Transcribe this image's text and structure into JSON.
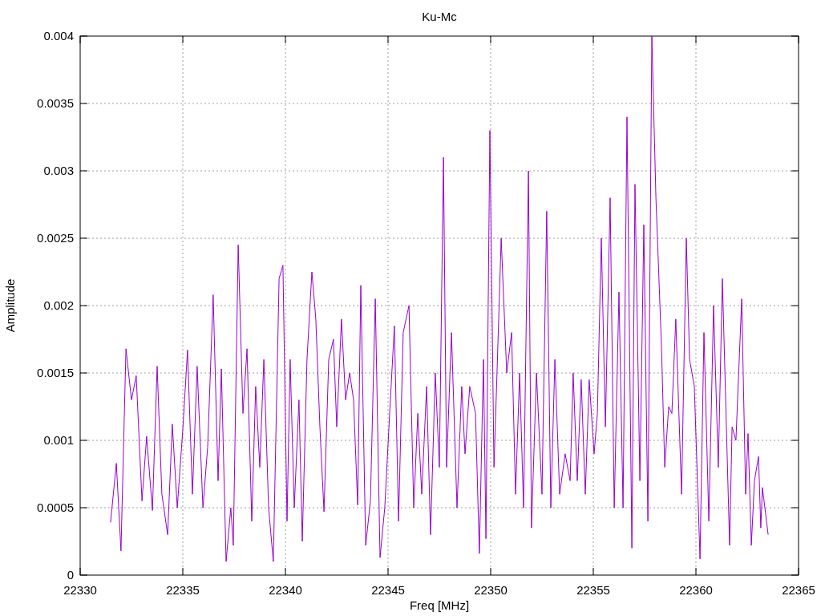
{
  "chart_data": {
    "type": "line",
    "grid": true,
    "title": "Ku-Mc",
    "xlabel": "Freq [MHz]",
    "ylabel": "Amplitude",
    "xlim": [
      22330,
      22365
    ],
    "ylim": [
      0,
      0.004
    ],
    "xticks": [
      22330,
      22335,
      22340,
      22345,
      22350,
      22355,
      22360,
      22365
    ],
    "yticks": [
      0,
      0.0005,
      0.001,
      0.0015,
      0.002,
      0.0025,
      0.003,
      0.0035,
      0.004
    ],
    "x": [
      22331.48,
      22331.76,
      22331.99,
      22332.23,
      22332.5,
      22332.73,
      22333.01,
      22333.24,
      22333.52,
      22333.75,
      22333.98,
      22334.26,
      22334.49,
      22334.73,
      22335,
      22335.23,
      22335.47,
      22335.7,
      22335.98,
      22336.21,
      22336.48,
      22336.72,
      22336.88,
      22337.11,
      22337.34,
      22337.46,
      22337.7,
      22337.93,
      22338.13,
      22338.36,
      22338.55,
      22338.75,
      22338.95,
      22339.18,
      22339.41,
      22339.69,
      22339.88,
      22340.08,
      22340.23,
      22340.43,
      22340.66,
      22340.82,
      22341.05,
      22341.29,
      22341.48,
      22341.68,
      22341.88,
      22342.11,
      22342.34,
      22342.5,
      22342.73,
      22342.93,
      22343.13,
      22343.32,
      22343.52,
      22343.67,
      22343.91,
      22344.14,
      22344.38,
      22344.61,
      22344.84,
      22345.08,
      22345.31,
      22345.51,
      22345.74,
      22346.02,
      22346.25,
      22346.45,
      22346.64,
      22346.88,
      22347.07,
      22347.3,
      22347.5,
      22347.7,
      22347.85,
      22348.09,
      22348.36,
      22348.59,
      22348.75,
      22348.98,
      22349.26,
      22349.45,
      22349.65,
      22349.77,
      22349.96,
      22350.16,
      22350.31,
      22350.51,
      22350.78,
      22351.02,
      22351.21,
      22351.41,
      22351.6,
      22351.84,
      22351.99,
      22352.23,
      22352.5,
      22352.73,
      22352.93,
      22353.13,
      22353.36,
      22353.63,
      22353.87,
      22354.02,
      22354.22,
      22354.41,
      22354.61,
      22354.8,
      22355.04,
      22355.2,
      22355.39,
      22355.59,
      22355.82,
      22356.02,
      22356.25,
      22356.45,
      22356.64,
      22356.88,
      22357.03,
      22357.27,
      22357.46,
      22357.66,
      22357.85,
      22358.05,
      22358.32,
      22358.48,
      22358.67,
      22358.83,
      22359.02,
      22359.3,
      22359.53,
      22359.69,
      22359.92,
      22360.2,
      22360.39,
      22360.63,
      22360.86,
      22361.09,
      22361.29,
      22361.52,
      22361.64,
      22361.76,
      22361.95,
      22362.23,
      22362.42,
      22362.54,
      22362.7,
      22362.85,
      22363.05,
      22363.16,
      22363.24,
      22363.52
    ],
    "series": [
      {
        "color": "#9400d3",
        "values": [
          0.00039,
          0.00083,
          0.00018,
          0.00168,
          0.0013,
          0.00148,
          0.00055,
          0.00103,
          0.00048,
          0.00155,
          0.0006,
          0.0003,
          0.00112,
          0.0005,
          0.00108,
          0.00167,
          0.0006,
          0.00155,
          0.0005,
          0.00095,
          0.00208,
          0.0007,
          0.00153,
          0.0001,
          0.0005,
          0.00022,
          0.00245,
          0.0012,
          0.00168,
          0.0004,
          0.0014,
          0.0008,
          0.0016,
          0.0005,
          0.0001,
          0.0022,
          0.0023,
          0.0004,
          0.0016,
          0.0005,
          0.0013,
          0.00025,
          0.0016,
          0.00225,
          0.0019,
          0.0011,
          0.00047,
          0.0016,
          0.00175,
          0.0011,
          0.0019,
          0.0013,
          0.0015,
          0.0013,
          0.00052,
          0.00215,
          0.00022,
          0.00055,
          0.00205,
          0.00013,
          0.0005,
          0.0012,
          0.00185,
          0.0004,
          0.0018,
          0.002,
          0.0005,
          0.0012,
          0.0006,
          0.0014,
          0.0003,
          0.0015,
          0.0008,
          0.0031,
          0.0008,
          0.0018,
          0.0005,
          0.0014,
          0.0009,
          0.0014,
          0.0012,
          0.00016,
          0.0016,
          0.00027,
          0.0033,
          0.0008,
          0.0015,
          0.0025,
          0.0015,
          0.0018,
          0.0006,
          0.0015,
          0.0005,
          0.003,
          0.00035,
          0.0015,
          0.0006,
          0.0027,
          0.0005,
          0.0016,
          0.0006,
          0.0009,
          0.0007,
          0.0015,
          0.0007,
          0.00145,
          0.0006,
          0.00145,
          0.0009,
          0.0012,
          0.0025,
          0.0011,
          0.0028,
          0.0005,
          0.0021,
          0.0005,
          0.0034,
          0.0002,
          0.0029,
          0.0007,
          0.0026,
          0.0004,
          0.004,
          0.0028,
          0.0017,
          0.0008,
          0.00125,
          0.0012,
          0.0019,
          0.0006,
          0.0025,
          0.0016,
          0.0014,
          0.00012,
          0.0018,
          0.0004,
          0.002,
          0.0008,
          0.0022,
          0.0009,
          0.00022,
          0.0011,
          0.001,
          0.00205,
          0.0006,
          0.00105,
          0.00022,
          0.0007,
          0.00088,
          0.00035,
          0.00065,
          0.0003
        ]
      }
    ]
  }
}
